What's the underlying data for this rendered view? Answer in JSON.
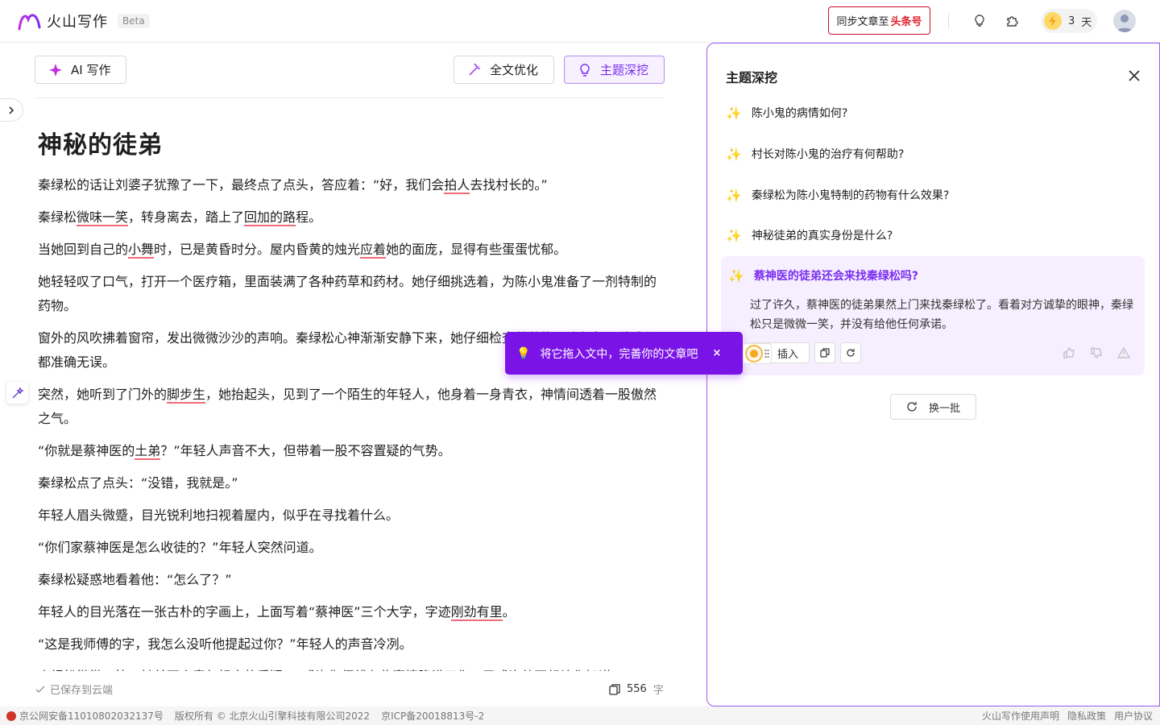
{
  "header": {
    "app_name": "火山写作",
    "beta_label": "Beta",
    "sync_label": "同步文章至",
    "sync_target": "头条号",
    "days_count": "3",
    "days_unit": "天"
  },
  "toolbar": {
    "ai_write": "AI 写作",
    "optimize": "全文优化",
    "deep_dive": "主题深挖"
  },
  "document": {
    "title": "神秘的徒弟",
    "paragraphs": [
      [
        "秦绿松的话让刘婆子犹豫了一下，最终点了点头，答应着：“好，我们会",
        {
          "e": "拍人"
        },
        "去找村长的。”"
      ],
      [
        "秦绿松",
        {
          "e": "微味一笑"
        },
        "，转身离去，踏上了",
        {
          "e": "回加的路"
        },
        "程。"
      ],
      [
        "当她回到自己的",
        {
          "e": "小舞"
        },
        "时，已是黄昏时分。屋内昏黄的烛光",
        {
          "e": "应着"
        },
        "她的面庞，显得有些蛋蛋忧郁。"
      ],
      [
        "她轻轻叹了口气，打开一个医疗箱，里面装满了各种药草和药材。她仔细挑选着，为陈小鬼准备了一剂特制的药物。"
      ],
      [
        "窗外的风吹拂着窗帘，发出微微沙沙的声响。秦绿松心神渐渐安静下来，她仔细检查着药物，确保每一种成分都准确无误。"
      ],
      [
        "突然，她听到了门外的",
        {
          "e": "脚步生"
        },
        "，她抬起头，见到了一个陌生的年轻人，他身着一身青衣，神情间透着一股傲然之气。"
      ],
      [
        "“你就是蔡神医的",
        {
          "e": "土弟"
        },
        "？”年轻人声音不大，但带着一股不容置疑的气势。"
      ],
      [
        "秦绿松点了点头：“没错，我就是。”"
      ],
      [
        "年轻人眉头微蹙，目光锐利地扫视着屋内，似乎在寻找着什么。"
      ],
      [
        "“你们家蔡神医是怎么收徒的？”年轻人突然问道。"
      ],
      [
        "秦绿松疑惑地看着他：“怎么了？”"
      ],
      [
        "年轻人的目光落在一张古朴的字画上，上面写着“蔡神医”三个大字，字迹",
        {
          "e": "刚劲有里"
        },
        "。"
      ],
      [
        "“这是我师傅的字，我怎么没听他提起过你？”年轻人的声音冷冽。"
      ],
      [
        "秦绿松微微一笑，她并不介意年轻人的质疑：“或许你师傅有些事情隐瞒了你，又或许他不想让你知道。”"
      ]
    ],
    "save_status": "已保存到云端",
    "word_count": "556",
    "word_unit": "字"
  },
  "panel": {
    "title": "主题深挖",
    "questions": [
      "陈小鬼的病情如何?",
      "村长对陈小鬼的治疗有何帮助?",
      "秦绿松为陈小鬼特制的药物有什么效果?",
      "神秘徒弟的真实身份是什么?"
    ],
    "active_question": "蔡神医的徒弟还会来找秦绿松吗?",
    "active_answer": "过了许久，蔡神医的徒弟果然上门来找秦绿松了。看着对方诚挚的眼神，秦绿松只是微微一笑，并没有给他任何承诺。",
    "insert_label": "插入",
    "refresh_label": "换一批"
  },
  "tooltip": {
    "text": "将它拖入文中，完善你的文章吧",
    "close": "×"
  },
  "footer": {
    "police_record": "京公网安备11010802032137号",
    "copyright": "版权所有 © 北京火山引擎科技有限公司2022",
    "icp": "京ICP备20018813号-2",
    "links": [
      "火山写作使用声明",
      "隐私政策",
      "用户协议"
    ]
  },
  "colors": {
    "accent": "#7a2ef0",
    "tooltip_bg": "#7a14e6",
    "error_underline": "#f06a7a",
    "sync_red": "#e0242e"
  }
}
